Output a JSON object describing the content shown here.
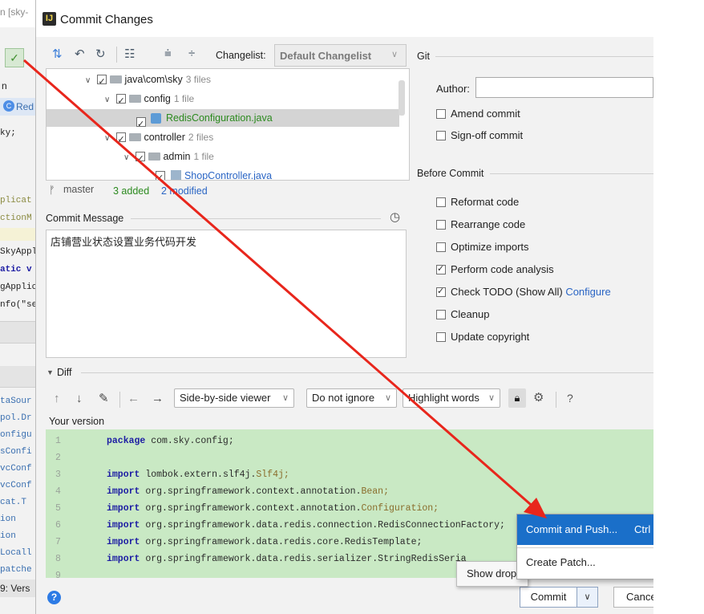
{
  "background_ide": {
    "title_fragment": "n [sky-",
    "left_label": "n",
    "tab_label": "Red",
    "code_fragments": [
      "ky;",
      "plicat",
      "ctionM",
      "SkyAppl",
      "atic v",
      "gApplic",
      "nfo(\"se"
    ],
    "list_fragments": [
      "taSour",
      "pol.Dr",
      "onfigu",
      "sConfi",
      "vcConf",
      "vcConf",
      "cat.T",
      "ion",
      "ion",
      "Locall",
      "patche"
    ],
    "bottom_tab": "9: Vers"
  },
  "dialog": {
    "title": "Commit Changes",
    "app_icon_letter": "IJ",
    "toolbar": {
      "changelist_label": "Changelist:",
      "changelist_value": "Default Changelist"
    },
    "tree": [
      {
        "name": "java\\com\\sky",
        "meta": "3 files",
        "checked": true,
        "type": "folder"
      },
      {
        "name": "config",
        "meta": "1 file",
        "checked": true,
        "type": "folder"
      },
      {
        "name": "RedisConfiguration.java",
        "meta": "",
        "checked": true,
        "type": "file"
      },
      {
        "name": "controller",
        "meta": "2 files",
        "checked": true,
        "type": "folder"
      },
      {
        "name": "admin",
        "meta": "1 file",
        "checked": true,
        "type": "folder"
      },
      {
        "name": "ShopController.java",
        "meta": "",
        "checked": true,
        "type": "file"
      }
    ],
    "branch": "master",
    "added": "3 added",
    "modified": "2 modified",
    "commit_message_label": "Commit Message",
    "commit_message": "店铺营业状态设置业务代码开发",
    "git": {
      "section_label": "Git",
      "author_label": "Author:",
      "author_value": "",
      "amend_label": "Amend commit",
      "signoff_label": "Sign-off commit"
    },
    "before_commit": {
      "section_label": "Before Commit",
      "options": [
        {
          "label": "Reformat code",
          "checked": false
        },
        {
          "label": "Rearrange code",
          "checked": false
        },
        {
          "label": "Optimize imports",
          "checked": false
        },
        {
          "label": "Perform code analysis",
          "checked": true
        },
        {
          "label": "Check TODO (Show All)",
          "checked": true
        },
        {
          "label": "Cleanup",
          "checked": false
        },
        {
          "label": "Update copyright",
          "checked": false
        }
      ],
      "configure_link": "Configure"
    },
    "diff": {
      "section_label": "Diff",
      "viewer": "Side-by-side viewer",
      "ignore": "Do not ignore",
      "highlight": "Highlight words",
      "help": "?",
      "version_label": "Your version",
      "code_lines": [
        {
          "n": "1",
          "kw": "package",
          "rest": " com.sky.config;",
          "cls": ""
        },
        {
          "n": "2",
          "kw": "",
          "rest": "",
          "cls": ""
        },
        {
          "n": "3",
          "kw": "import",
          "rest": " lombok.extern.slf4j.",
          "cls": "Slf4j;"
        },
        {
          "n": "4",
          "kw": "import",
          "rest": " org.springframework.context.annotation.",
          "cls": "Bean;"
        },
        {
          "n": "5",
          "kw": "import",
          "rest": " org.springframework.context.annotation.",
          "cls": "Configuration;"
        },
        {
          "n": "6",
          "kw": "import",
          "rest": " org.springframework.data.redis.connection.RedisConnectionFactory;",
          "cls": ""
        },
        {
          "n": "7",
          "kw": "import",
          "rest": " org.springframework.data.redis.core.RedisTemplate;",
          "cls": ""
        },
        {
          "n": "8",
          "kw": "import",
          "rest": " org.springframework.data.redis.serializer.StringRedisSeria",
          "cls": ""
        },
        {
          "n": "9",
          "kw": "",
          "rest": "",
          "cls": ""
        }
      ]
    },
    "popup": {
      "push_label": "Commit and Push...",
      "push_shortcut": "Ctrl",
      "patch_label": "Create Patch..."
    },
    "tooltip": "Show drop",
    "buttons": {
      "commit": "Commit",
      "cancel": "Cance",
      "help": "?"
    }
  },
  "colors": {
    "accent": "#1a6fc9",
    "diff_added_bg": "#c9e9c4",
    "file_added": "#2c8a1f",
    "link": "#2a65c4",
    "annotation_arrow": "#e8261c"
  }
}
